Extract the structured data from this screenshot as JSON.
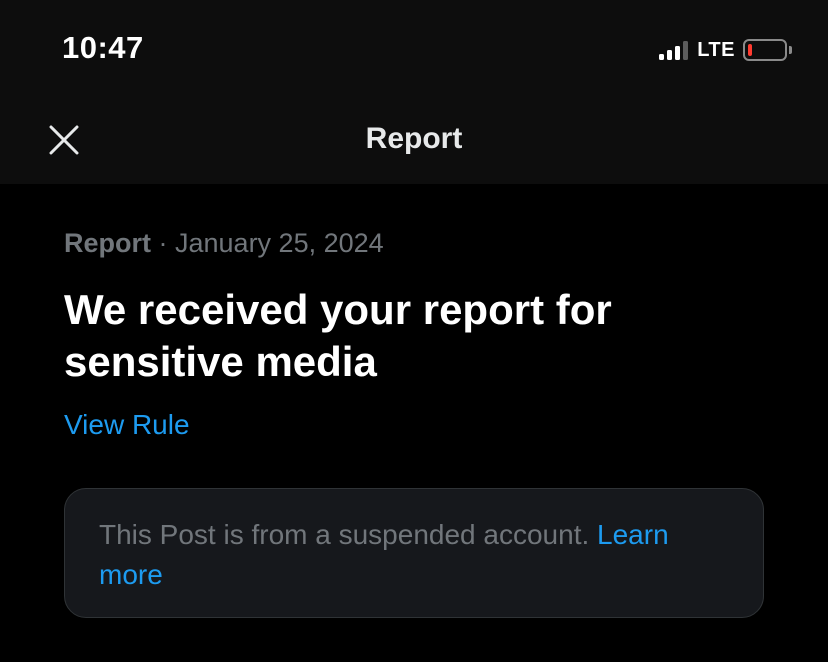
{
  "status_bar": {
    "time": "10:47",
    "network": "LTE",
    "battery_level": 0.1,
    "battery_color": "#ff3b30",
    "signal_bars_active": 3,
    "signal_bars_total": 4
  },
  "header": {
    "title": "Report",
    "close_icon": "close-icon"
  },
  "report": {
    "label": "Report",
    "separator": " · ",
    "date": "January 25, 2024",
    "headline": "We received your report for sensitive media",
    "view_rule_label": "View Rule"
  },
  "notice": {
    "text": "This Post is from a suspended account. ",
    "link_label": "Learn more"
  },
  "colors": {
    "background": "#000000",
    "header_background": "#0d0d0d",
    "accent": "#1d9bf0",
    "muted_text": "#71767b",
    "card_background": "#16181c"
  }
}
